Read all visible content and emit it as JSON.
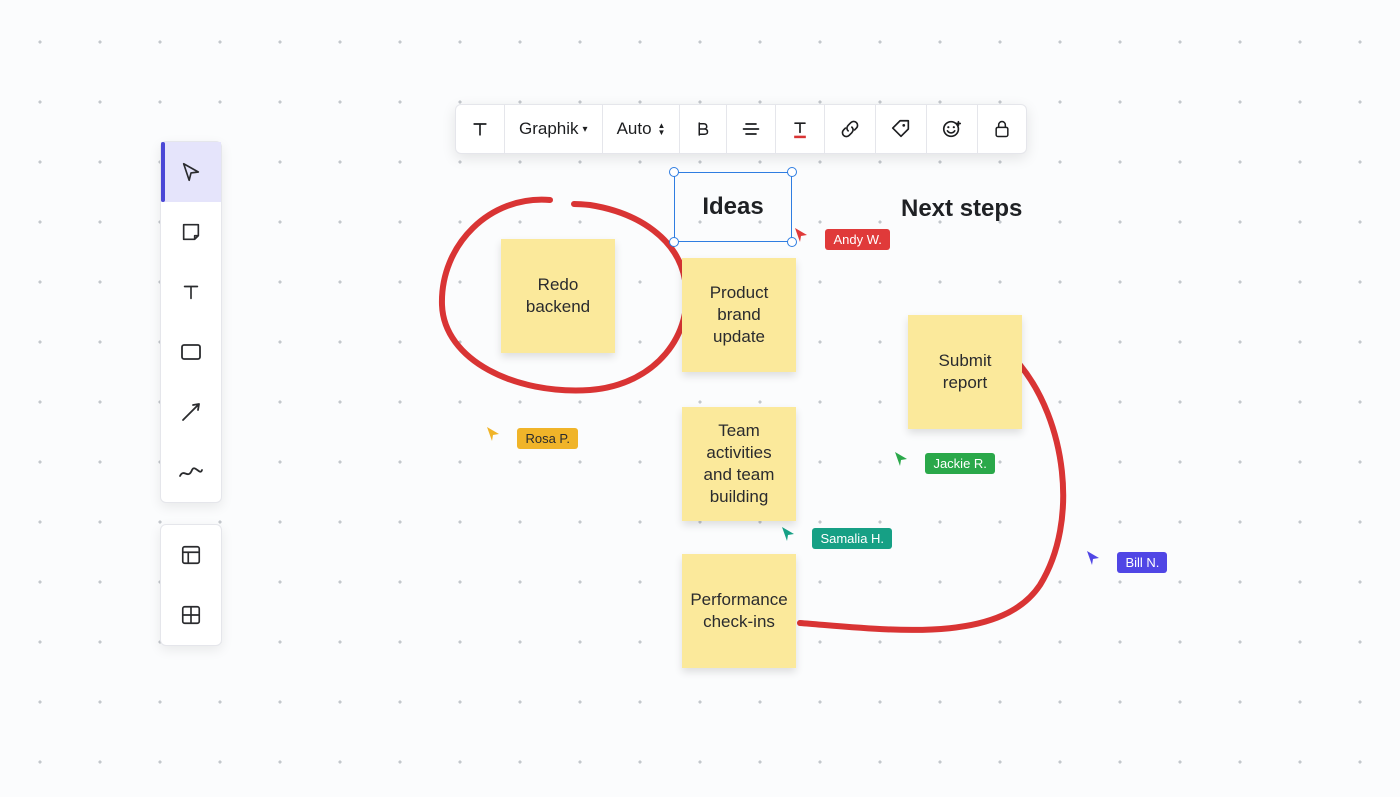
{
  "format_bar": {
    "font_family": "Graphik",
    "font_size_mode": "Auto"
  },
  "toolbar": {
    "tools": [
      {
        "name": "select",
        "selected": true
      },
      {
        "name": "sticky"
      },
      {
        "name": "text"
      },
      {
        "name": "rectangle"
      },
      {
        "name": "arrow"
      },
      {
        "name": "freehand"
      }
    ],
    "panel_tools": [
      {
        "name": "layout-panel"
      },
      {
        "name": "grid-panel"
      }
    ]
  },
  "headings": {
    "selected": "Ideas",
    "next": "Next steps"
  },
  "stickies": {
    "redo_backend": "Redo backend",
    "product_brand": "Product brand update",
    "team_activities": "Team activities and team building",
    "performance": "Performance check-ins",
    "submit_report": "Submit report"
  },
  "collaborators": {
    "andy": {
      "name": "Andy W.",
      "color": "#e03a3a"
    },
    "rosa": {
      "name": "Rosa P.",
      "color": "#f0b429"
    },
    "samalia": {
      "name": "Samalia H.",
      "color": "#16a085"
    },
    "jackie": {
      "name": "Jackie R.",
      "color": "#2aa84a"
    },
    "bill": {
      "name": "Bill N.",
      "color": "#5046e5"
    }
  }
}
